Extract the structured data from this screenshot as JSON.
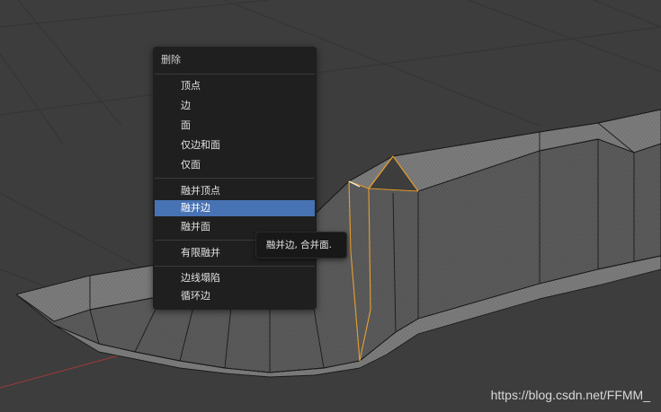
{
  "delete_menu": {
    "title": "删除",
    "items": [
      {
        "label": "顶点"
      },
      {
        "label": "边"
      },
      {
        "label": "面"
      },
      {
        "label": "仅边和面"
      },
      {
        "label": "仅面"
      },
      {
        "label": "融并顶点"
      },
      {
        "label": "融并边",
        "state": "highlighted"
      },
      {
        "label": "融并面"
      },
      {
        "label": "有限融并"
      },
      {
        "label": "边线塌陷"
      },
      {
        "label": "循环边"
      }
    ]
  },
  "tooltip": {
    "text": "融并边, 合并面."
  },
  "watermark": {
    "text": "https://blog.csdn.net/FFMM_"
  },
  "colors": {
    "background": "#3d3d3d",
    "mesh_face": "#7d7d7d",
    "menu_bg": "#1f1f1f",
    "highlight": "#4772b3",
    "selected_edge": "#e8a030",
    "x_axis": "#9a3a3a"
  }
}
